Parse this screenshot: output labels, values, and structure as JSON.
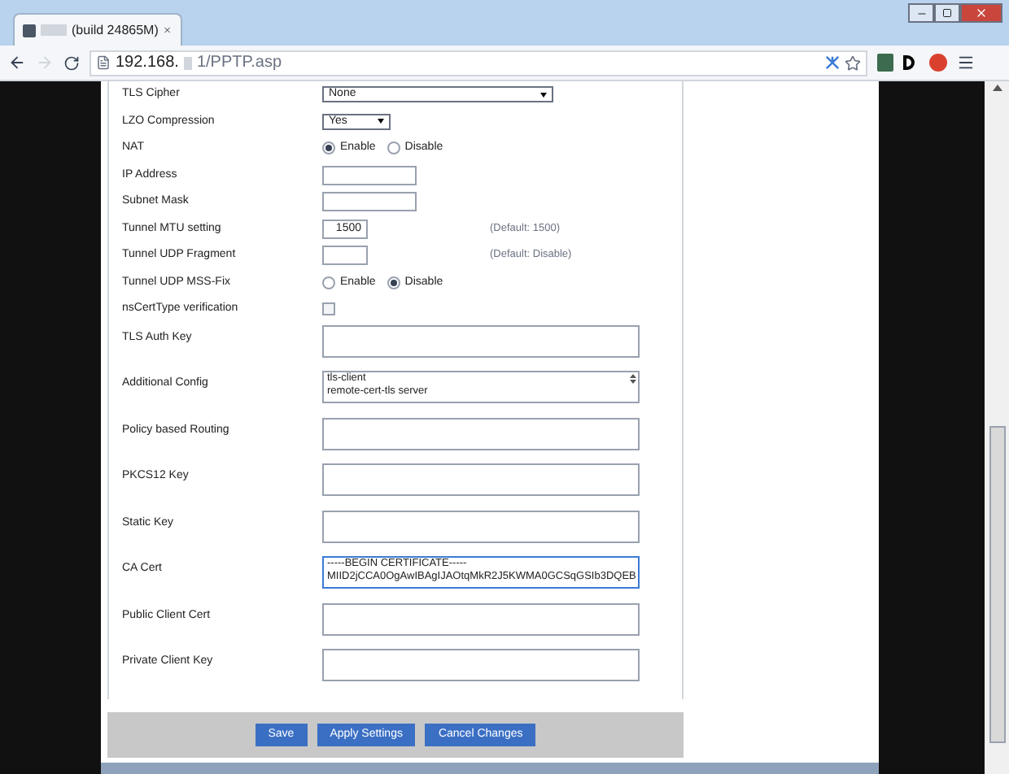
{
  "browser": {
    "tab_title": "(build 24865M)",
    "url_host": "192.168.",
    "url_rest": "1/PPTP.asp"
  },
  "fields": [
    {
      "label": "TLS Cipher",
      "kind": "select",
      "wide": true,
      "value": "None"
    },
    {
      "label": "LZO Compression",
      "kind": "select",
      "wide": false,
      "value": "Yes"
    },
    {
      "label": "NAT",
      "kind": "radio",
      "options": [
        {
          "label": "Enable",
          "selected": true
        },
        {
          "label": "Disable",
          "selected": false
        }
      ]
    },
    {
      "label": "IP Address",
      "kind": "text",
      "wide": true
    },
    {
      "label": "Subnet Mask",
      "kind": "text",
      "wide": true
    },
    {
      "label": "Tunnel MTU setting",
      "kind": "text",
      "wide": false,
      "value": "1500",
      "note": "(Default: 1500)"
    },
    {
      "label": "Tunnel UDP Fragment",
      "kind": "text",
      "wide": false,
      "note": "(Default: Disable)"
    },
    {
      "label": "Tunnel UDP MSS-Fix",
      "kind": "radio",
      "options": [
        {
          "label": "Enable",
          "selected": false
        },
        {
          "label": "Disable",
          "selected": true
        }
      ]
    },
    {
      "label": "nsCertType verification",
      "kind": "checkbox",
      "checked": false
    },
    {
      "label": "TLS Auth Key",
      "kind": "textarea",
      "focused": false
    },
    {
      "label": "Additional Config",
      "kind": "textarea",
      "focused": false,
      "lines": [
        "tls-client",
        "remote-cert-tls server"
      ]
    },
    {
      "label": "Policy based Routing",
      "kind": "textarea",
      "focused": false
    },
    {
      "label": "PKCS12 Key",
      "kind": "textarea",
      "focused": false
    },
    {
      "label": "Static Key",
      "kind": "textarea",
      "focused": false
    },
    {
      "label": "CA Cert",
      "kind": "textarea",
      "focused": true,
      "lines": [
        "-----BEGIN CERTIFICATE-----",
        "MIID2jCCA0OgAwIBAgIJAOtqMkR2J5KWMA0GCSqGSIb3DQEB"
      ]
    },
    {
      "label": "Public Client Cert",
      "kind": "textarea",
      "focused": false
    },
    {
      "label": "Private Client Key",
      "kind": "textarea",
      "focused": false
    }
  ],
  "buttons": [
    "Save",
    "Apply Settings",
    "Cancel Changes"
  ]
}
